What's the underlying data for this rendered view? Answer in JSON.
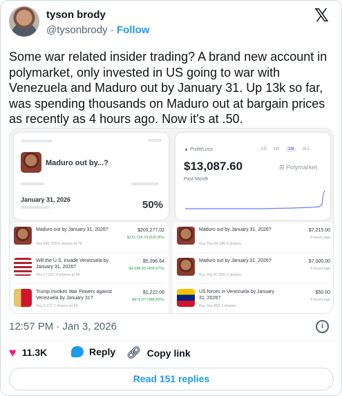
{
  "author": {
    "display_name": "tyson brody",
    "handle": "@tysonbrody",
    "separator": "·",
    "follow_label": "Follow"
  },
  "tweet": {
    "text": "Some war related insider trading? A brand new account in polymarket, only invested in US going to war with Venezuela and Maduro out by January 31. Up 13k so far, was spending thousands on Maduro out at bargain prices as recently as 4 hours ago. Now it's at .50."
  },
  "media": {
    "market": {
      "title": "Maduro out by...?",
      "date_label": "January 31, 2026",
      "percent": "50%"
    },
    "profit": {
      "label": "▲ Profit/Loss",
      "value": "$13,087.60",
      "period": "Past Month",
      "brand": "Polymarket",
      "tabs": [
        "1D",
        "1W",
        "1M",
        "ALL"
      ],
      "active_tab": "1M"
    },
    "positions": [
      {
        "title": "Maduro out by January 31, 2026?",
        "amount": "$205,277.02",
        "sub": "$172,734.74 (530.8%)",
        "meta": "Yes 436,759.6 shares at 7¢"
      },
      {
        "title": "Will the U.S. invade Venezuela by January 31, 2026?",
        "amount": "$5,096.64",
        "sub": "$4,096.65 (409.67%)",
        "meta": "Yes 17,657.9 shares at 6¢"
      },
      {
        "title": "Trump invokes War Powers against Venezuela by January 31?",
        "amount": "$1,222.06",
        "sub": "$972.07 (388.85%)",
        "meta": "Yes 5,371.7 shares at 5¢"
      }
    ],
    "activity": [
      {
        "title": "Maduro out by January 31, 2026?",
        "amount": "$7,215.00",
        "sub": "4 hours ago",
        "meta": "Buy Yes 84,186.8 shares"
      },
      {
        "title": "Maduro out by January 31, 2026?",
        "amount": "$7,000.00",
        "sub": "4 hours ago",
        "meta": "Buy Yes 87,500.0 shares"
      },
      {
        "title": "US forces in Venezuela by January 31, 2026?",
        "amount": "$50.00",
        "sub": "4 hours ago",
        "meta": "Buy Yes 893.7 shares"
      }
    ]
  },
  "footer": {
    "timestamp": "12:57 PM · Jan 3, 2026",
    "likes": "11.3K",
    "reply_label": "Reply",
    "copy_link_label": "Copy link",
    "read_replies_label": "Read 151 replies"
  },
  "icons": {
    "x_logo": "x-logo-icon",
    "info": "info-icon",
    "heart": "heart-icon",
    "reply": "reply-icon",
    "link": "link-icon"
  },
  "colors": {
    "accent": "#1d9bf0",
    "heart": "#f91880",
    "secondary_text": "#536471",
    "gain": "#2c9b52",
    "chart_line": "#6b7cff"
  }
}
